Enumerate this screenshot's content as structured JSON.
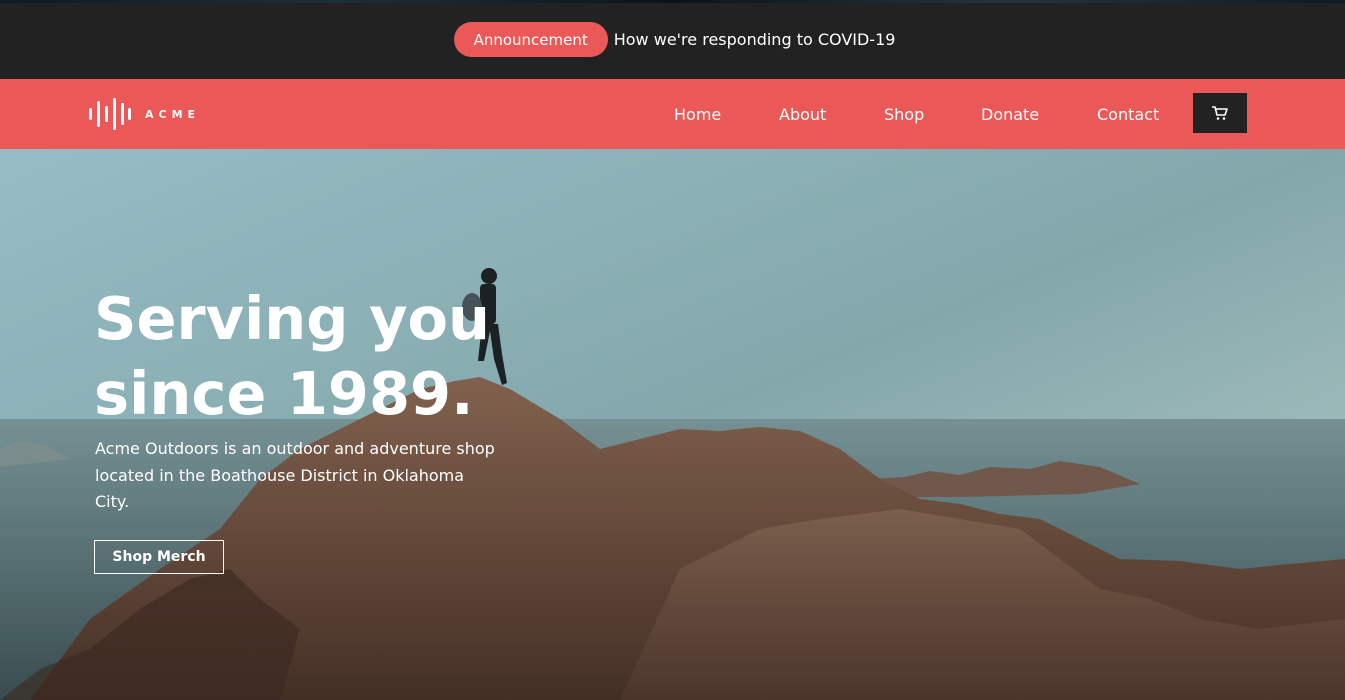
{
  "announcement": {
    "badge": "Announcement",
    "text": "How we're responding to COVID-19"
  },
  "nav": {
    "logo_text": "ACME",
    "links": [
      "Home",
      "About",
      "Shop",
      "Donate",
      "Contact"
    ],
    "cart_icon": "cart-icon"
  },
  "hero": {
    "title_line1": "Serving you",
    "title_line2": "since 1989.",
    "description": "Acme Outdoors is an outdoor and adventure shop located in the Boathouse District in Oklahoma City.",
    "button": "Shop Merch"
  },
  "colors": {
    "accent": "#eb5858",
    "dark": "#222222"
  }
}
